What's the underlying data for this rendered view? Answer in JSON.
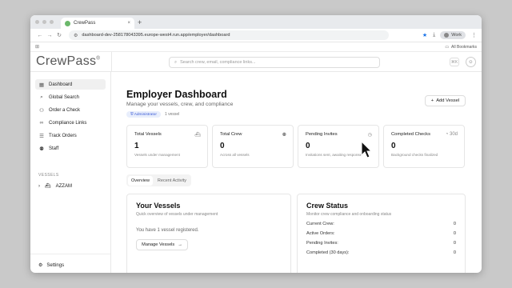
{
  "browser": {
    "tab_title": "CrewPass",
    "new_tab": "+",
    "close": "×",
    "url": "dashboard-dev-258178043395.europe-west4.run.app/employer/dashboard",
    "profile": "Work",
    "all_bookmarks": "All Bookmarks"
  },
  "app": {
    "logo": "CrewPass",
    "logo_mark": "®",
    "search_placeholder": "Search crew, email, compliance links...",
    "kbd": "⌘K"
  },
  "sidebar": {
    "items": [
      {
        "label": "Dashboard",
        "icon": "grid-icon"
      },
      {
        "label": "Global Search",
        "icon": "search-icon"
      },
      {
        "label": "Order a Check",
        "icon": "user-plus-icon"
      },
      {
        "label": "Compliance Links",
        "icon": "link-icon"
      },
      {
        "label": "Track Orders",
        "icon": "list-icon"
      },
      {
        "label": "Staff",
        "icon": "users-icon"
      }
    ],
    "section_label": "VESSELS",
    "vessel": "AZZAM",
    "settings": "Settings"
  },
  "main": {
    "title": "Employer Dashboard",
    "subtitle": "Manage your vessels, crew, and compliance",
    "role_badge": "Administrator",
    "vessel_count": "1 vessel",
    "add_vessel": "Add Vessel",
    "stats": [
      {
        "label": "Total Vessels",
        "value": "1",
        "desc": "Vessels under management",
        "icon": "ship-icon"
      },
      {
        "label": "Total Crew",
        "value": "0",
        "desc": "Across all vessels",
        "icon": "users-icon"
      },
      {
        "label": "Pending Invites",
        "value": "0",
        "desc": "Invitations sent, awaiting response",
        "icon": "clock-icon"
      },
      {
        "label": "Completed Checks",
        "value": "0",
        "desc": "Background checks finalized",
        "icon": "check-icon",
        "note": "30d"
      }
    ],
    "tabs": [
      "Overview",
      "Recent Activity"
    ],
    "vessels_panel": {
      "title": "Your Vessels",
      "subtitle": "Quick overview of vessels under management",
      "text": "You have 1 vessel registered.",
      "button": "Manage Vessels"
    },
    "crew_panel": {
      "title": "Crew Status",
      "subtitle": "Monitor crew compliance and onboarding status",
      "rows": [
        {
          "label": "Current Crew:",
          "value": "0"
        },
        {
          "label": "Active Orders:",
          "value": "0"
        },
        {
          "label": "Pending Invites:",
          "value": "0"
        },
        {
          "label": "Completed (30 days):",
          "value": "0"
        }
      ]
    }
  }
}
